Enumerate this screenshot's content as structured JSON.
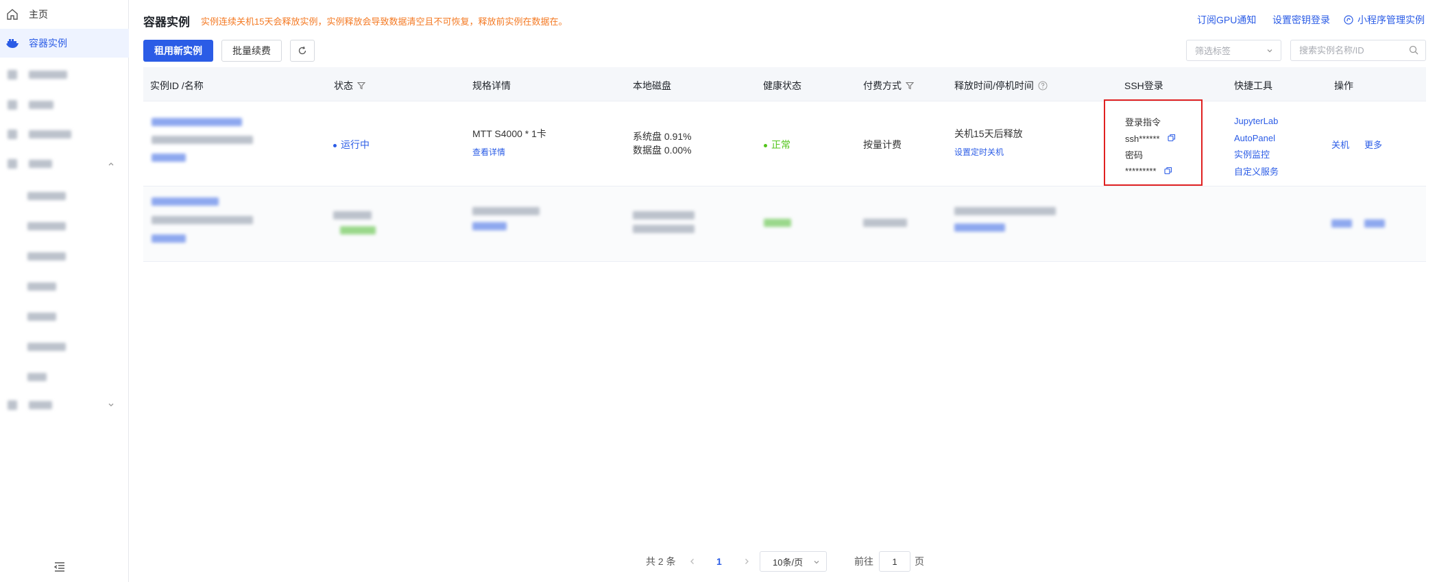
{
  "sidebar": {
    "home_label": "主页",
    "active_label": "容器实例"
  },
  "header": {
    "title": "容器实例",
    "warning": "实例连续关机15天会释放实例，实例释放会导致数据清空且不可恢复，释放前实例在数据在。",
    "links": {
      "gpu_notify": "订阅GPU通知",
      "ssh_key": "设置密钥登录",
      "miniprogram": "小程序管理实例"
    }
  },
  "toolbar": {
    "rent_button": "租用新实例",
    "renew_button": "批量续费",
    "tag_filter_placeholder": "筛选标签",
    "search_placeholder": "搜索实例名称/ID"
  },
  "table": {
    "columns": [
      "实例ID /名称",
      "状态",
      "规格详情",
      "本地磁盘",
      "健康状态",
      "付费方式",
      "释放时间/停机时间",
      "SSH登录",
      "快捷工具",
      "操作"
    ],
    "row1": {
      "status": "运行中",
      "spec": "MTT S4000 * 1卡",
      "spec_link": "查看详情",
      "disk_system": "系统盘 0.91%",
      "disk_data": "数据盘 0.00%",
      "health": "正常",
      "billing": "按量计费",
      "release": "关机15天后释放",
      "release_link": "设置定时关机",
      "ssh_cmd_label": "登录指令",
      "ssh_cmd": "ssh******",
      "ssh_pwd_label": "密码",
      "ssh_pwd": "*********",
      "tools": [
        "JupyterLab",
        "AutoPanel",
        "实例监控",
        "自定义服务"
      ],
      "actions": {
        "shutdown": "关机",
        "more": "更多"
      }
    }
  },
  "pagination": {
    "total": "共 2 条",
    "current_page": "1",
    "page_size": "10条/页",
    "goto_label": "前往",
    "goto_value": "1",
    "page_unit": "页"
  },
  "colors": {
    "accent": "#2b5ce6",
    "warning": "#f47a24",
    "success": "#52c41a",
    "highlight_border": "#e02020"
  }
}
